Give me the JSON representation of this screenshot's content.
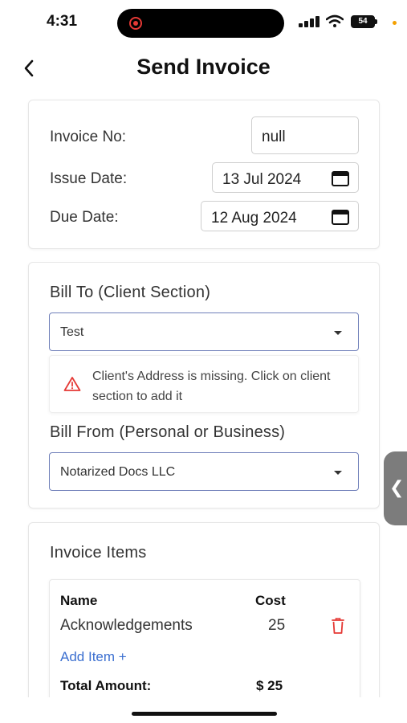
{
  "status_bar": {
    "time": "4:31",
    "battery": "54",
    "accent_color": "#e53935"
  },
  "header": {
    "title": "Send Invoice",
    "back_icon": "chevron-left-icon"
  },
  "invoice_details": {
    "invoice_no_label": "Invoice No:",
    "invoice_no_value": "null",
    "issue_date_label": "Issue Date:",
    "issue_date_value": "13 Jul 2024",
    "due_date_label": "Due Date:",
    "due_date_value": "12 Aug 2024",
    "date_icon": "calendar-icon"
  },
  "bill_to": {
    "heading": "Bill To (Client Section)",
    "selected_client": "Test",
    "warning_text": "Client's Address is missing. Click on client section to add it",
    "warning_icon": "warning-triangle-icon",
    "warning_color": "#e53935"
  },
  "bill_from": {
    "heading": "Bill From (Personal or Business)",
    "selected_business": "Notarized Docs LLC"
  },
  "invoice_items": {
    "heading": "Invoice Items",
    "columns": [
      "Name",
      "Cost"
    ],
    "items": [
      {
        "name": "Acknowledgements",
        "cost": "25"
      }
    ],
    "add_item_label": "Add Item +",
    "total_label": "Total Amount:",
    "total_value": "$ 25",
    "link_color": "#3b6fd0"
  },
  "side_handle": {
    "glyph": "❮"
  }
}
